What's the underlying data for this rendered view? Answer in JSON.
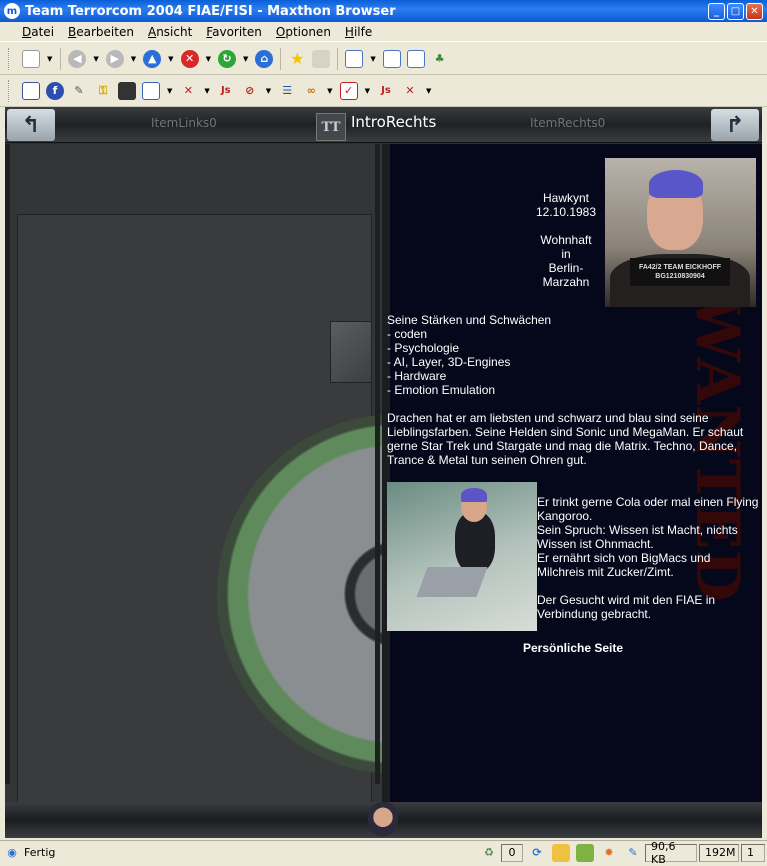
{
  "window": {
    "title": "Team Terrorcom 2004 FIAE/FISI - Maxthon Browser",
    "app_icon": "maxthon-icon"
  },
  "menu": [
    "Datei",
    "Bearbeiten",
    "Ansicht",
    "Favoriten",
    "Optionen",
    "Hilfe"
  ],
  "page": {
    "item_left": "ItemLinks0",
    "item_right": "ItemRechts0",
    "logo": "TT",
    "header_title": "IntroRechts",
    "profile": {
      "name": "Hawkynt",
      "birthdate": "12.10.1983",
      "residence_label": "Wohnhaft",
      "residence_in": "in",
      "residence_city_1": "Berlin-",
      "residence_city_2": "Marzahn",
      "sign_line_1": "FA42/2 TEAM EICKHOFF",
      "sign_line_2": "BG1210830904",
      "strengths_title": "Seine Stärken und Schwächen",
      "strengths": [
        "- coden",
        "- Psychologie",
        "- AI, Layer, 3D-Engines",
        "- Hardware",
        "- Emotion Emulation"
      ],
      "bio_1": "Drachen hat er am liebsten und schwarz und blau sind seine Lieblingsfarben. Seine Helden sind Sonic und MegaMan. Er schaut gerne Star Trek und Stargate und mag die Matrix. Techno, Dance, Trance & Metal tun seinen Ohren gut.",
      "bio_2a": "Er trinkt gerne Cola oder mal einen Flying Kangoroo.",
      "bio_2b": "Sein Spruch: Wissen ist Macht, nichts Wissen ist Ohnmacht.",
      "bio_2c": "Er ernährt sich von BigMacs und Milchreis mit Zucker/Zimt.",
      "bio_3": "Der Gesucht wird mit den FIAE in Verbindung gebracht.",
      "link": "Persönliche Seite"
    }
  },
  "status": {
    "text": "Fertig",
    "popups": "0",
    "size": "90,6 KB",
    "memory": "192M",
    "tabs": "1"
  },
  "colors": {
    "titlebar": "#0b5ad4",
    "content_bg": "#05081a",
    "hair": "#5856c8"
  }
}
